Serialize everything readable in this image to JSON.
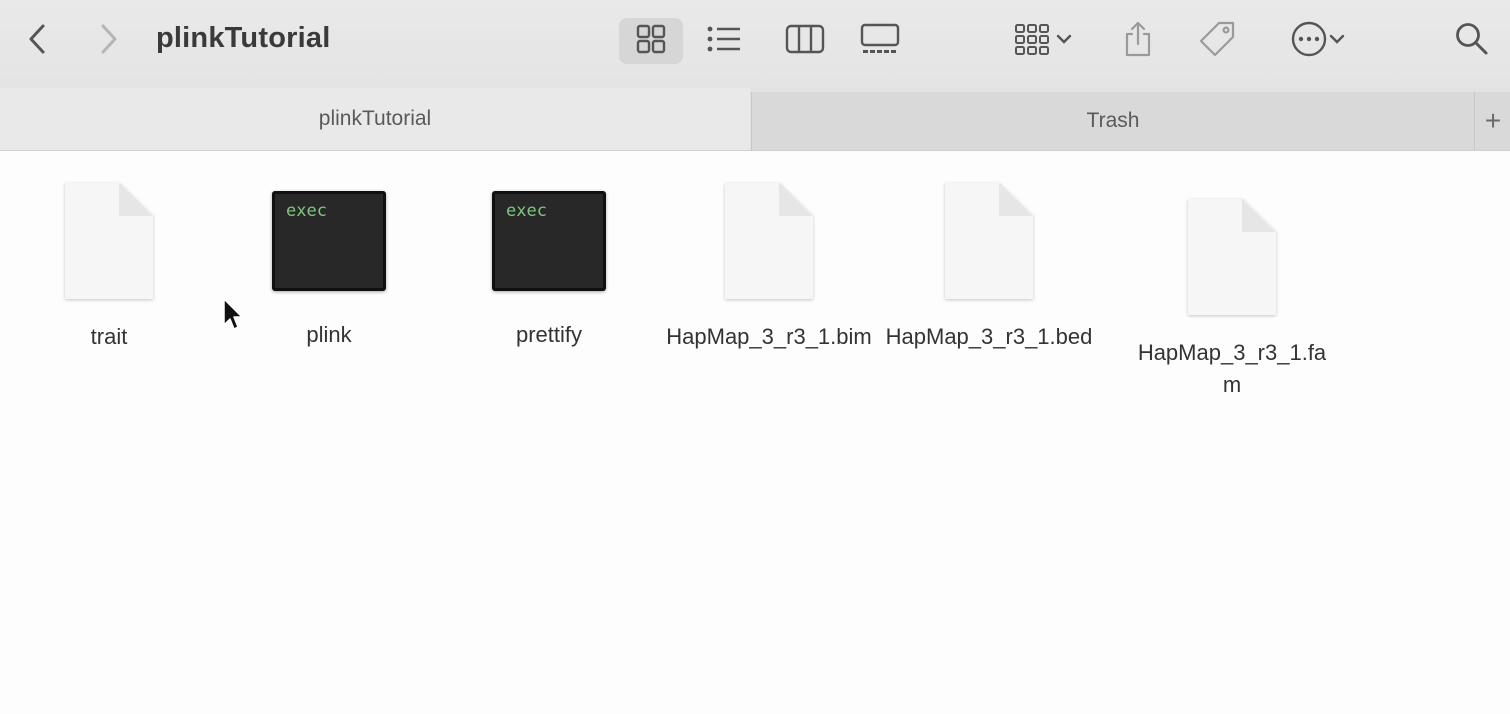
{
  "window": {
    "title": "plinkTutorial"
  },
  "toolbar": {
    "back": "back",
    "forward": "forward",
    "views": [
      "icon-view",
      "list-view",
      "column-view",
      "gallery-view"
    ],
    "active_view": "icon-view"
  },
  "tabs": [
    {
      "label": "plinkTutorial",
      "active": true
    },
    {
      "label": "Trash",
      "active": false
    }
  ],
  "files": [
    {
      "name": "trait",
      "kind": "document"
    },
    {
      "name": "plink",
      "kind": "exec",
      "badge": "exec"
    },
    {
      "name": "prettify",
      "kind": "exec",
      "badge": "exec"
    },
    {
      "name": "HapMap_3_r3_1.bim",
      "kind": "document"
    },
    {
      "name": "HapMap_3_r3_1.bed",
      "kind": "document"
    },
    {
      "name": "HapMap_3_r3_1.fam",
      "kind": "document"
    }
  ],
  "colors": {
    "toolbar_bg": "#e6e6e6",
    "exec_text": "#7fc77f",
    "exec_bg": "#282828"
  }
}
